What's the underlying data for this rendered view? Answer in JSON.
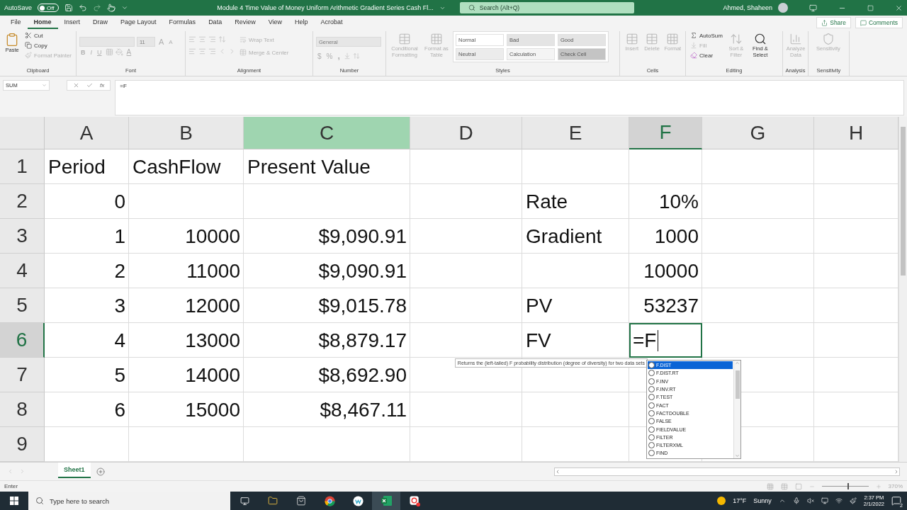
{
  "title_bar": {
    "autosave_label": "AutoSave",
    "autosave": {
      "on": false,
      "label": "Off"
    },
    "document_title": "Module 4 Time Value of Money Uniform Arithmetic Gradient Series Cash Fl...",
    "search_placeholder": "Search (Alt+Q)",
    "user_name": "Ahmed, Shaheen"
  },
  "ribbon_tabs": [
    {
      "label": "File",
      "selected": false
    },
    {
      "label": "Home",
      "selected": true
    },
    {
      "label": "Insert",
      "selected": false
    },
    {
      "label": "Draw",
      "selected": false
    },
    {
      "label": "Page Layout",
      "selected": false
    },
    {
      "label": "Formulas",
      "selected": false
    },
    {
      "label": "Data",
      "selected": false
    },
    {
      "label": "Review",
      "selected": false
    },
    {
      "label": "View",
      "selected": false
    },
    {
      "label": "Help",
      "selected": false
    },
    {
      "label": "Acrobat",
      "selected": false
    }
  ],
  "share": "Share",
  "comments": "Comments",
  "ribbon_groups": [
    {
      "kind": "clipboard",
      "label": "Clipboard",
      "paste": {
        "label": "Paste",
        "disabled": false
      },
      "cut": {
        "label": "Cut",
        "disabled": false
      },
      "copy": {
        "label": "Copy",
        "disabled": false
      },
      "format_painter": {
        "label": "Format Painter",
        "disabled": true
      }
    },
    {
      "kind": "font",
      "label": "Font",
      "size": "11",
      "grow": "A",
      "shrink": "A",
      "bold": "B",
      "italic": "I",
      "underline": "U",
      "font_color": "A"
    },
    {
      "kind": "alignment",
      "label": "Alignment",
      "wrap_text": "Wrap Text",
      "merge": "Merge & Center"
    },
    {
      "kind": "number",
      "label": "Number",
      "format": "General",
      "currency": "$",
      "percent": "%",
      "comma": ","
    },
    {
      "kind": "styles",
      "label": "Styles",
      "conditional": "Conditional Formatting",
      "format_table": "Format as Table",
      "styles": [
        {
          "label": "Normal",
          "color": "#ffffff"
        },
        {
          "label": "Bad",
          "color": "#e4e4e4"
        },
        {
          "label": "Good",
          "color": "#e4e4e4"
        },
        {
          "label": "Neutral",
          "color": "#ececec"
        },
        {
          "label": "Calculation",
          "color": "#f4f4f4"
        },
        {
          "label": "Check Cell",
          "color": "#c4c4c4"
        }
      ]
    },
    {
      "kind": "cells",
      "label": "Cells",
      "insert": "Insert",
      "delete": "Delete",
      "format": "Format"
    },
    {
      "kind": "editing",
      "label": "Editing",
      "autosum": {
        "label": "AutoSum",
        "disabled": false
      },
      "fill": {
        "label": "Fill",
        "disabled": true
      },
      "clear": {
        "label": "Clear",
        "disabled": false
      },
      "sort_filter": {
        "label": "Sort & Filter",
        "disabled": true
      },
      "find_select": {
        "label": "Find & Select",
        "disabled": false
      }
    },
    {
      "kind": "analysis",
      "label": "Analysis",
      "analyze": "Analyze Data"
    },
    {
      "kind": "sensitivity",
      "label": "Sensitivity",
      "sensitivity": "Sensitivity"
    }
  ],
  "formula_bar": {
    "name_box": "SUM",
    "function_label": "fx",
    "formula": "=F"
  },
  "sheet": {
    "columns": [
      {
        "label": "A",
        "selected": false,
        "hover": false
      },
      {
        "label": "B",
        "selected": false,
        "hover": false
      },
      {
        "label": "C",
        "selected": false,
        "hover": true
      },
      {
        "label": "D",
        "selected": false,
        "hover": false
      },
      {
        "label": "E",
        "selected": false,
        "hover": false
      },
      {
        "label": "F",
        "selected": true,
        "hover": false
      },
      {
        "label": "G",
        "selected": false,
        "hover": false
      },
      {
        "label": "H",
        "selected": false,
        "hover": false
      }
    ],
    "rows": [
      {
        "number": "1",
        "selected": false,
        "cells": [
          {
            "kind": "text",
            "text": "Period"
          },
          {
            "kind": "text",
            "text": "CashFlow"
          },
          {
            "kind": "text",
            "text": "Present Value"
          },
          {
            "kind": "blank"
          },
          {
            "kind": "blank"
          },
          {
            "kind": "blank"
          },
          {
            "kind": "blank"
          },
          {
            "kind": "blank"
          }
        ]
      },
      {
        "number": "2",
        "selected": false,
        "cells": [
          {
            "kind": "number",
            "text": "0"
          },
          {
            "kind": "blank"
          },
          {
            "kind": "blank"
          },
          {
            "kind": "blank"
          },
          {
            "kind": "text",
            "text": "Rate"
          },
          {
            "kind": "number",
            "text": "10%"
          },
          {
            "kind": "blank"
          },
          {
            "kind": "blank"
          }
        ]
      },
      {
        "number": "3",
        "selected": false,
        "cells": [
          {
            "kind": "number",
            "text": "1"
          },
          {
            "kind": "number",
            "text": "10000"
          },
          {
            "kind": "number",
            "text": "$9,090.91"
          },
          {
            "kind": "blank"
          },
          {
            "kind": "text",
            "text": "Gradient"
          },
          {
            "kind": "number",
            "text": "1000"
          },
          {
            "kind": "blank"
          },
          {
            "kind": "blank"
          }
        ]
      },
      {
        "number": "4",
        "selected": false,
        "cells": [
          {
            "kind": "number",
            "text": "2"
          },
          {
            "kind": "number",
            "text": "11000"
          },
          {
            "kind": "number",
            "text": "$9,090.91"
          },
          {
            "kind": "blank"
          },
          {
            "kind": "blank"
          },
          {
            "kind": "number",
            "text": "10000"
          },
          {
            "kind": "blank"
          },
          {
            "kind": "blank"
          }
        ]
      },
      {
        "number": "5",
        "selected": false,
        "cells": [
          {
            "kind": "number",
            "text": "3"
          },
          {
            "kind": "number",
            "text": "12000"
          },
          {
            "kind": "number",
            "text": "$9,015.78"
          },
          {
            "kind": "blank"
          },
          {
            "kind": "text",
            "text": "PV"
          },
          {
            "kind": "number",
            "text": "53237"
          },
          {
            "kind": "blank"
          },
          {
            "kind": "blank"
          }
        ]
      },
      {
        "number": "6",
        "selected": true,
        "cells": [
          {
            "kind": "number",
            "text": "4"
          },
          {
            "kind": "number",
            "text": "13000"
          },
          {
            "kind": "number",
            "text": "$8,879.17"
          },
          {
            "kind": "blank"
          },
          {
            "kind": "text",
            "text": "FV"
          },
          {
            "kind": "editing",
            "text": "=F"
          },
          {
            "kind": "blank"
          },
          {
            "kind": "blank"
          }
        ]
      },
      {
        "number": "7",
        "selected": false,
        "cells": [
          {
            "kind": "number",
            "text": "5"
          },
          {
            "kind": "number",
            "text": "14000"
          },
          {
            "kind": "number",
            "text": "$8,692.90"
          },
          {
            "kind": "blank"
          },
          {
            "kind": "blank"
          },
          {
            "kind": "blank"
          },
          {
            "kind": "blank"
          },
          {
            "kind": "blank"
          }
        ]
      },
      {
        "number": "8",
        "selected": false,
        "cells": [
          {
            "kind": "number",
            "text": "6"
          },
          {
            "kind": "number",
            "text": "15000"
          },
          {
            "kind": "number",
            "text": "$8,467.11"
          },
          {
            "kind": "blank"
          },
          {
            "kind": "blank"
          },
          {
            "kind": "blank"
          },
          {
            "kind": "blank"
          },
          {
            "kind": "blank"
          }
        ]
      },
      {
        "number": "9",
        "selected": false,
        "cells": [
          {
            "kind": "blank"
          },
          {
            "kind": "blank"
          },
          {
            "kind": "blank"
          },
          {
            "kind": "blank"
          },
          {
            "kind": "blank"
          },
          {
            "kind": "blank"
          },
          {
            "kind": "blank"
          },
          {
            "kind": "blank"
          }
        ]
      }
    ]
  },
  "function_tooltip": "Returns the (left-tailed) F probability distribution (degree of diversity) for two data sets",
  "autocomplete": [
    {
      "label": "F.DIST",
      "selected": true
    },
    {
      "label": "F.DIST.RT",
      "selected": false
    },
    {
      "label": "F.INV",
      "selected": false
    },
    {
      "label": "F.INV.RT",
      "selected": false
    },
    {
      "label": "F.TEST",
      "selected": false
    },
    {
      "label": "FACT",
      "selected": false
    },
    {
      "label": "FACTDOUBLE",
      "selected": false
    },
    {
      "label": "FALSE",
      "selected": false
    },
    {
      "label": "FIELDVALUE",
      "selected": false
    },
    {
      "label": "FILTER",
      "selected": false
    },
    {
      "label": "FILTERXML",
      "selected": false
    },
    {
      "label": "FIND",
      "selected": false
    }
  ],
  "sheet_tabs": [
    {
      "label": "Sheet1",
      "selected": true
    }
  ],
  "status_bar": {
    "mode": "Enter",
    "zoom": {
      "label": "370%",
      "level": 0.55
    }
  },
  "taskbar": {
    "search_placeholder": "Type here to search",
    "temperature": "17°F",
    "weather": "Sunny",
    "time": "2:37 PM",
    "date": "2/1/2022",
    "notifications": "2"
  }
}
